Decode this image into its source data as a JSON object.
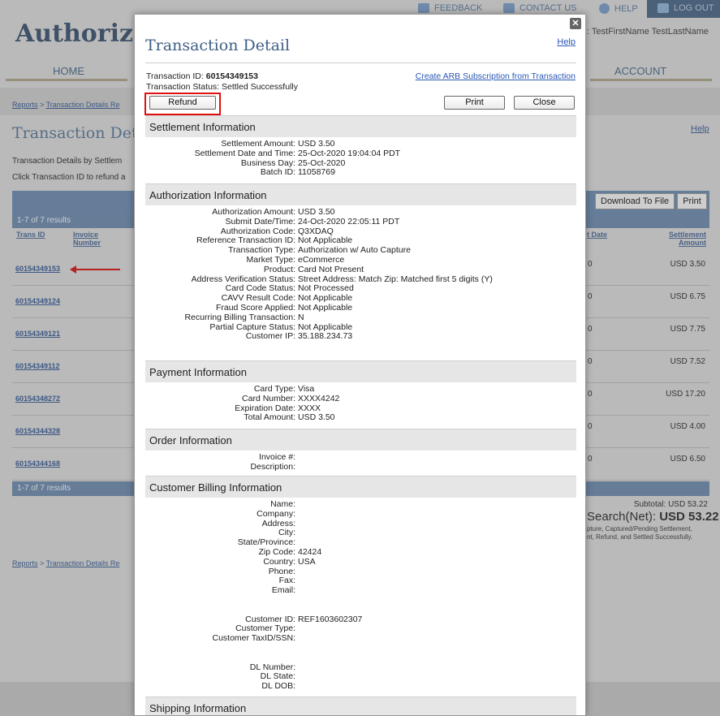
{
  "topbar": {
    "feedback": "FEEDBACK",
    "contact": "CONTACT US",
    "help": "HELP",
    "logout": "LOG OUT"
  },
  "brand": "Authorize",
  "welcome": ": TestFirstName TestLastName",
  "nav": {
    "home": "HOME",
    "account": "ACCOUNT"
  },
  "background": {
    "breadcrumb_reports": "Reports",
    "breadcrumb_sep": " > ",
    "breadcrumb_details": "Transaction Details Re",
    "page_title": "Transaction Deta",
    "help": "Help",
    "desc1": "Transaction Details by Settlem",
    "desc2": "Click Transaction ID to refund a",
    "download": "Download To File",
    "print": "Print",
    "results": "1-7 of 7 results",
    "col_trans_id": "Trans ID",
    "col_invoice": "Invoice Number",
    "col_date": "t Date",
    "col_amount": "Settlement Amount",
    "rows": [
      {
        "id": "60154349153",
        "date": "0",
        "amount": "USD 3.50"
      },
      {
        "id": "60154349124",
        "date": "0",
        "amount": "USD 6.75"
      },
      {
        "id": "60154349121",
        "date": "0",
        "amount": "USD 7.75"
      },
      {
        "id": "60154349112",
        "date": "0",
        "amount": "USD 7.52"
      },
      {
        "id": "60154348272",
        "date": "0",
        "amount": "USD 17.20"
      },
      {
        "id": "60154344328",
        "date": "0",
        "amount": "USD 4.00"
      },
      {
        "id": "60154344168",
        "date": "0",
        "amount": "USD 6.50"
      }
    ],
    "results_bottom": "1-7 of 7 results",
    "subtotal": "Subtotal: USD 53.22",
    "net_label": "Search(Net): ",
    "net_value": "USD 53.22",
    "note1": "pture, Captured/Pending Settlement,",
    "note2": "nt, Refund, and Settled Successfully."
  },
  "modal": {
    "title": "Transaction Detail",
    "help": "Help",
    "close": "✕",
    "txid_label": "Transaction ID: ",
    "txid_value": "60154349153",
    "status": "Transaction Status: Settled Successfully",
    "arb_link": "Create ARB Subscription from Transaction",
    "refund": "Refund",
    "print": "Print",
    "close_btn": "Close",
    "sections": {
      "settlement": "Settlement Information",
      "authorization": "Authorization Information",
      "payment": "Payment Information",
      "order": "Order Information",
      "billing": "Customer Billing Information",
      "shipping": "Shipping Information"
    },
    "settlement": [
      [
        "Settlement Amount:",
        "USD 3.50"
      ],
      [
        "Settlement Date and Time:",
        "25-Oct-2020 19:04:04 PDT"
      ],
      [
        "Business Day:",
        "25-Oct-2020"
      ],
      [
        "Batch ID:",
        "11058769"
      ]
    ],
    "authorization": [
      [
        "Authorization Amount:",
        "USD 3.50"
      ],
      [
        "Submit Date/Time:",
        "24-Oct-2020 22:05:11 PDT"
      ],
      [
        "Authorization Code:",
        "Q3XDAQ"
      ],
      [
        "Reference Transaction ID:",
        "Not Applicable"
      ],
      [
        "Transaction Type:",
        "Authorization w/ Auto Capture"
      ],
      [
        "Market Type:",
        "eCommerce"
      ],
      [
        "Product:",
        "Card Not Present"
      ],
      [
        "Address Verification Status:",
        "Street Address: Match Zip: Matched first 5 digits (Y)"
      ],
      [
        "Card Code Status:",
        "Not Processed"
      ],
      [
        "CAVV Result Code:",
        "Not Applicable"
      ],
      [
        "Fraud Score Applied:",
        "Not Applicable"
      ],
      [
        "Recurring Billing Transaction:",
        "N"
      ],
      [
        "Partial Capture Status:",
        "Not Applicable"
      ],
      [
        "Customer IP:",
        "35.188.234.73"
      ]
    ],
    "payment": [
      [
        "Card Type:",
        "Visa"
      ],
      [
        "Card Number:",
        "XXXX4242"
      ],
      [
        "Expiration Date:",
        "XXXX"
      ],
      [
        "Total Amount:",
        "USD 3.50"
      ]
    ],
    "order": [
      [
        "Invoice #:",
        ""
      ],
      [
        "Description:",
        ""
      ]
    ],
    "billing": [
      [
        "Name:",
        ""
      ],
      [
        "Company:",
        ""
      ],
      [
        "Address:",
        ""
      ],
      [
        "City:",
        ""
      ],
      [
        "State/Province:",
        ""
      ],
      [
        "Zip Code:",
        "42424"
      ],
      [
        "Country:",
        "USA"
      ],
      [
        "Phone:",
        ""
      ],
      [
        "Fax:",
        ""
      ],
      [
        "Email:",
        ""
      ],
      [
        "",
        ""
      ],
      [
        "",
        ""
      ],
      [
        "Customer ID:",
        "REF1603602307"
      ],
      [
        "Customer Type:",
        ""
      ],
      [
        "Customer TaxID/SSN:",
        ""
      ],
      [
        "",
        ""
      ],
      [
        "",
        ""
      ],
      [
        "DL Number:",
        ""
      ],
      [
        "DL State:",
        ""
      ],
      [
        "DL DOB:",
        ""
      ]
    ]
  }
}
